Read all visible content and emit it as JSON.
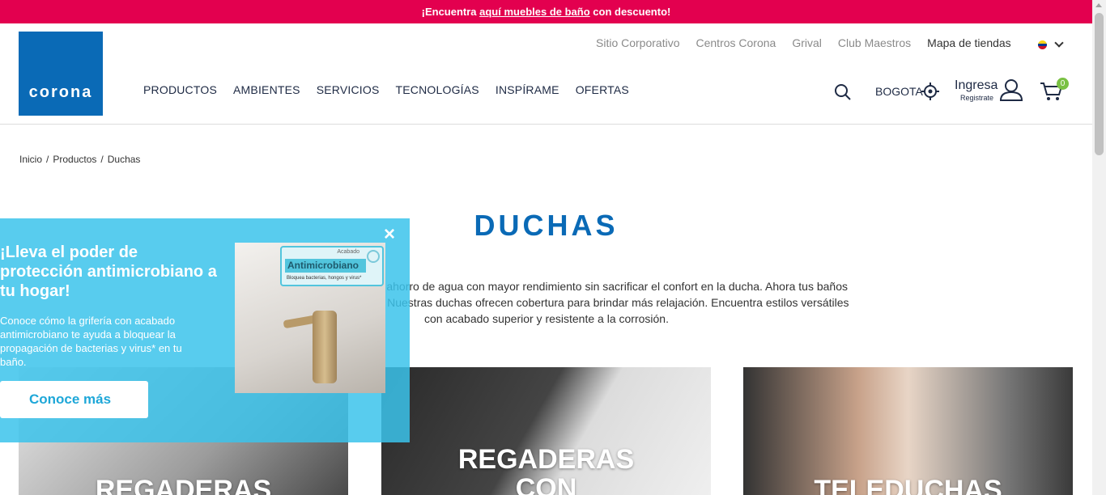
{
  "promo": {
    "pre": "¡Encuentra ",
    "link": "aquí muebles de baño",
    "post": " con descuento!"
  },
  "logo": "corona",
  "top_links": [
    "Sitio Corporativo",
    "Centros Corona",
    "Grival",
    "Club Maestros",
    "Mapa de tiendas"
  ],
  "main_nav": [
    "PRODUCTOS",
    "AMBIENTES",
    "SERVICIOS",
    "TECNOLOGÍAS",
    "INSPÍRAME",
    "OFERTAS"
  ],
  "city": "BOGOTA",
  "account": {
    "label": "Ingresa",
    "sub": "Registrate"
  },
  "cart": {
    "count": "0"
  },
  "breadcrumb": {
    "home": "Inicio",
    "sep": "/",
    "products": "Productos",
    "current": "Duchas"
  },
  "page": {
    "title": "DUCHAS",
    "intro": "Disfruta de la tecnología de ahorro de agua con mayor rendimiento sin sacrificar el confort en la ducha. Ahora tus baños serán toda una experiencia. Nuestras duchas ofrecen cobertura para brindar más relajación. Encuentra estilos versátiles con acabado superior y resistente a la corrosión."
  },
  "cards": [
    {
      "title": "REGADERAS"
    },
    {
      "title": "REGADERAS CON"
    },
    {
      "title": "TELEDUCHAS"
    }
  ],
  "popup": {
    "title": "¡Lleva el poder de protección antimicrobiano a tu hogar!",
    "text": "Conoce cómo la grifería con acabado antimicrobiano te ayuda a bloquear la propagación de bacterias y virus* en tu baño.",
    "button": "Conoce más",
    "close": "×",
    "badge_top": "Acabado",
    "badge_title": "Antimicrobiano",
    "badge_sub": "Bloquea bacterias, hongos y virus*"
  },
  "colors": {
    "promo": "#e3004f",
    "brand": "#0a6ab6",
    "cart_badge": "#7ac143",
    "popup": "#3bc3eb"
  }
}
